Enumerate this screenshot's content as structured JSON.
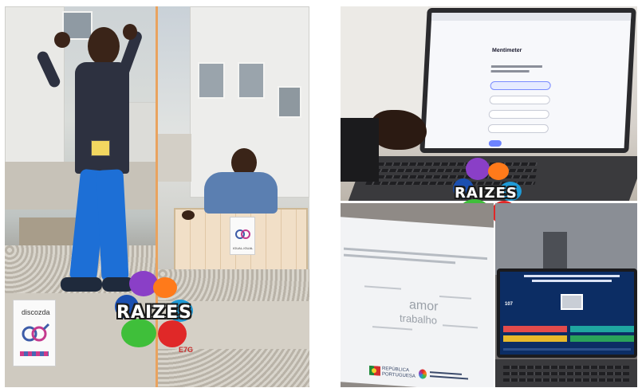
{
  "left": {
    "sign_a_text": "discozda",
    "sign_b_text": "IGUAL-IGUAL"
  },
  "logo": {
    "word": "RAIZES",
    "sub": "E7G"
  },
  "right_top": {
    "brand": "Mentimeter"
  },
  "right_bottom_left": {
    "footer_rep_line1": "REPÚBLICA",
    "footer_rep_line2": "PORTUGUESA",
    "words": [
      "amor",
      "trabalho"
    ]
  },
  "right_bottom_right": {
    "quiz_number": "107"
  },
  "colors": {
    "hoodie": "#2d3140",
    "pants": "#1d6fd6",
    "jacket": "#5b7fb1",
    "menti_accent": "#6d83ff",
    "quiz_bg": "#0c2d64",
    "quiz_red": "#e34b4b",
    "quiz_green": "#2aa35a",
    "quiz_yellow": "#e8b92a",
    "quiz_teal": "#1fa6a0"
  }
}
